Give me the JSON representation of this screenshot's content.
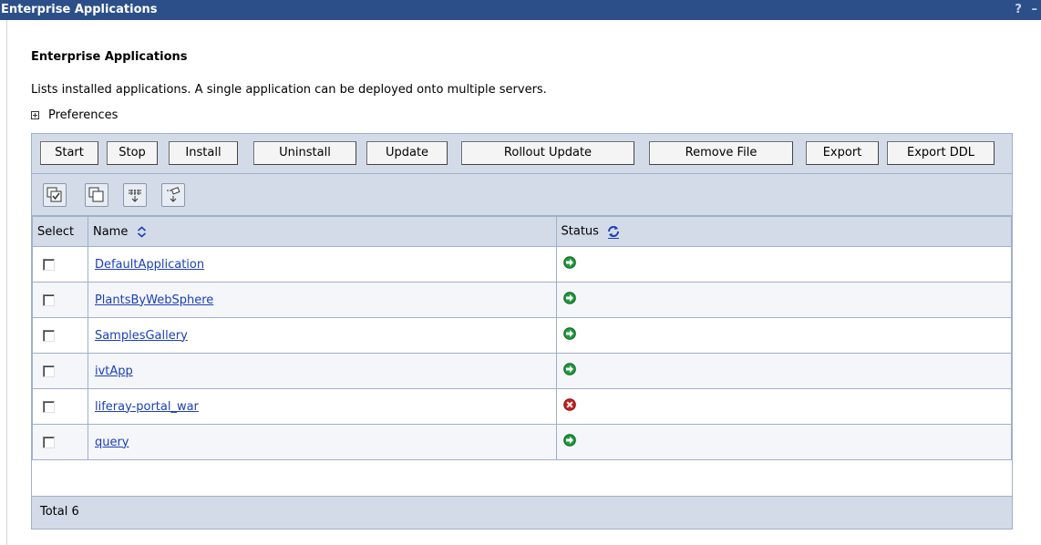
{
  "window": {
    "title": "Enterprise Applications",
    "help_label": "?",
    "minimize_label": "–"
  },
  "page": {
    "heading": "Enterprise Applications",
    "description": "Lists installed applications. A single application can be deployed onto multiple servers.",
    "preferences_label": "Preferences"
  },
  "toolbar": {
    "buttons": [
      {
        "label": "Start"
      },
      {
        "label": "Stop"
      },
      {
        "label": "Install"
      },
      {
        "label": "Uninstall"
      },
      {
        "label": "Update"
      },
      {
        "label": "Rollout Update"
      },
      {
        "label": "Remove File"
      },
      {
        "label": "Export"
      },
      {
        "label": "Export DDL"
      }
    ]
  },
  "icon_toolbar": [
    "select-all-icon",
    "deselect-all-icon",
    "show-filter-icon",
    "clear-filter-icon"
  ],
  "table": {
    "columns": {
      "select": "Select",
      "name": "Name",
      "status": "Status"
    },
    "rows": [
      {
        "name": "DefaultApplication",
        "status": "started"
      },
      {
        "name": "PlantsByWebSphere",
        "status": "started"
      },
      {
        "name": "SamplesGallery",
        "status": "started"
      },
      {
        "name": "ivtApp",
        "status": "started"
      },
      {
        "name": "liferay-portal_war",
        "status": "stopped"
      },
      {
        "name": "query",
        "status": "started"
      }
    ],
    "total_label": "Total 6"
  },
  "colors": {
    "titlebar": "#2c4f8a",
    "panel": "#d3dbe8",
    "link": "#1b3fb8",
    "started": "#1e9a3c",
    "stopped": "#cc1f1f"
  }
}
